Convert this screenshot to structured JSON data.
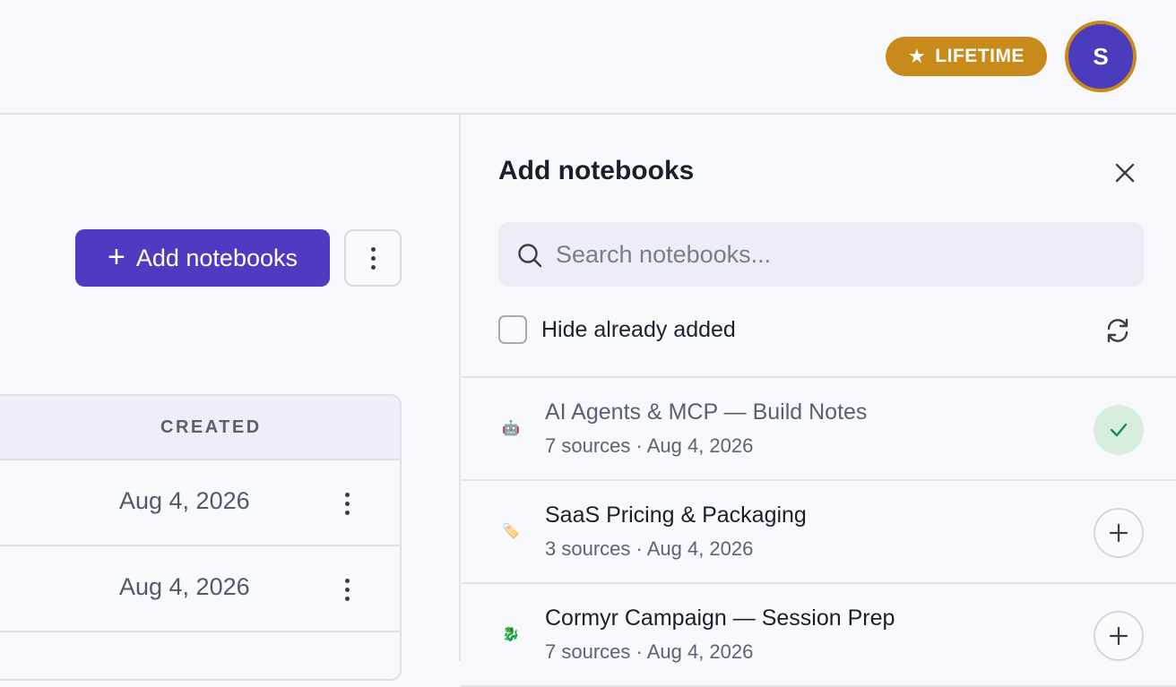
{
  "header": {
    "badge_label": "LIFETIME",
    "badge_icon": "star-icon",
    "avatar_initial": "S",
    "badge_color": "#c98a1c",
    "avatar_color": "#4b3bbd"
  },
  "main": {
    "add_button_label": "Add notebooks",
    "accent_color": "#4e3bc1",
    "table": {
      "columns": [
        "CREATED"
      ],
      "rows": [
        {
          "created": "Aug 4, 2026"
        },
        {
          "created": "Aug 4, 2026"
        }
      ]
    }
  },
  "panel": {
    "title": "Add notebooks",
    "search_placeholder": "Search notebooks...",
    "hide_added_label": "Hide already added",
    "hide_added_checked": false,
    "notebooks": [
      {
        "emoji": "🤖",
        "icon": "robot-icon",
        "name": "AI Agents & MCP — Build Notes",
        "meta": "7 sources · Aug 4, 2026",
        "added": true
      },
      {
        "emoji": "🏷️",
        "icon": "tag-icon",
        "name": "SaaS Pricing & Packaging",
        "meta": "3 sources · Aug 4, 2026",
        "added": false
      },
      {
        "emoji": "🐉",
        "icon": "dragon-icon",
        "name": "Cormyr Campaign — Session Prep",
        "meta": "7 sources · Aug 4, 2026",
        "added": false
      }
    ]
  }
}
